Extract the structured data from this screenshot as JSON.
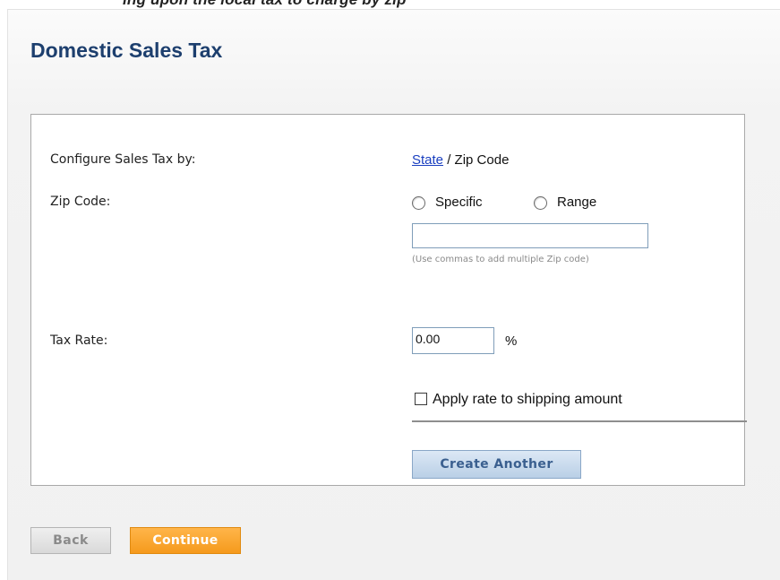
{
  "banner": {
    "text": "ing upon the local tax to charge by zip"
  },
  "page": {
    "title": "Domestic Sales Tax"
  },
  "form": {
    "configure_label": "Configure Sales Tax by:",
    "configure_state_link": "State",
    "configure_separator": " / ",
    "configure_zip_option": "Zip Code",
    "zip_label": "Zip Code:",
    "zip_mode_specific": "Specific",
    "zip_mode_range": "Range",
    "zip_value": "",
    "zip_hint": "(Use commas to add multiple Zip code)",
    "tax_rate_label": "Tax Rate:",
    "tax_rate_value": "0.00",
    "tax_rate_unit": "%",
    "apply_shipping_label": "Apply rate to shipping amount",
    "apply_shipping_checked": false,
    "create_another_label": "Create Another"
  },
  "footer": {
    "back_label": "Back",
    "continue_label": "Continue"
  },
  "colors": {
    "title": "#1d3f6e",
    "link": "#1a3fc0",
    "continue_button": "#f59a1c",
    "create_button": "#b9cfe6"
  }
}
